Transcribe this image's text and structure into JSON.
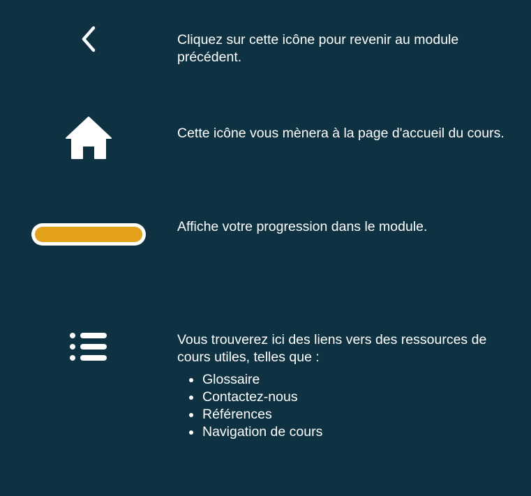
{
  "colors": {
    "background": "#0f3242",
    "text": "#ffffff",
    "progress_fill": "#e4a11b",
    "progress_track": "#ffffff"
  },
  "rows": [
    {
      "icon": "chevron-left-icon",
      "text": "Cliquez sur cette icône pour revenir au module précédent."
    },
    {
      "icon": "home-icon",
      "text": "Cette icône vous mènera à la page d'accueil du cours."
    },
    {
      "icon": "progress-bar",
      "text": "Affiche votre progression dans le module.",
      "progress": 1.0
    },
    {
      "icon": "list-icon",
      "text": "Vous trouverez ici des liens vers des ressources de cours utiles, telles que :",
      "items": [
        "Glossaire",
        "Contactez-nous",
        "Références",
        "Navigation de cours"
      ]
    }
  ]
}
